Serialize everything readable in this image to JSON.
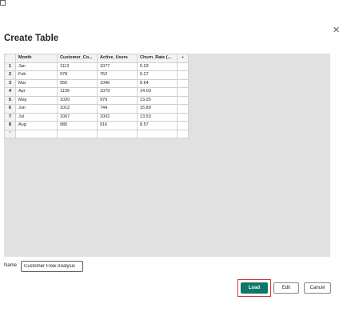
{
  "dialog": {
    "title": "Create Table",
    "window_controls": {
      "maximize_glyph": "□",
      "close_glyph": "✕"
    }
  },
  "table": {
    "add_column_label": "+",
    "new_row_label": "*",
    "columns": [
      "Month",
      "Customer_Co...",
      "Active_Users",
      "Churn_Rate (..."
    ],
    "rows": [
      {
        "num": "1",
        "cells": [
          "Jan",
          "1113",
          "1077",
          "5.03"
        ]
      },
      {
        "num": "2",
        "cells": [
          "Feb",
          "978",
          "752",
          "6.27"
        ]
      },
      {
        "num": "3",
        "cells": [
          "Mar",
          "956",
          "1046",
          "8.64"
        ]
      },
      {
        "num": "4",
        "cells": [
          "Apr",
          "1139",
          "1079",
          "14.03"
        ]
      },
      {
        "num": "5",
        "cells": [
          "May",
          "1020",
          "979",
          "13.25"
        ]
      },
      {
        "num": "6",
        "cells": [
          "Jun",
          "1012",
          "744",
          "15.89"
        ]
      },
      {
        "num": "7",
        "cells": [
          "Jul",
          "1007",
          "1002",
          "13.53"
        ]
      },
      {
        "num": "8",
        "cells": [
          "Aug",
          "985",
          "916",
          "8.57"
        ]
      }
    ]
  },
  "name_field": {
    "label": "Name:",
    "value": "Customer Flow Analysis"
  },
  "buttons": {
    "load": "Load",
    "edit": "Edit",
    "cancel": "Cancel"
  },
  "colors": {
    "primary": "#117865",
    "focus_outline": "#d13438",
    "grid_background": "#e1e1e1"
  }
}
